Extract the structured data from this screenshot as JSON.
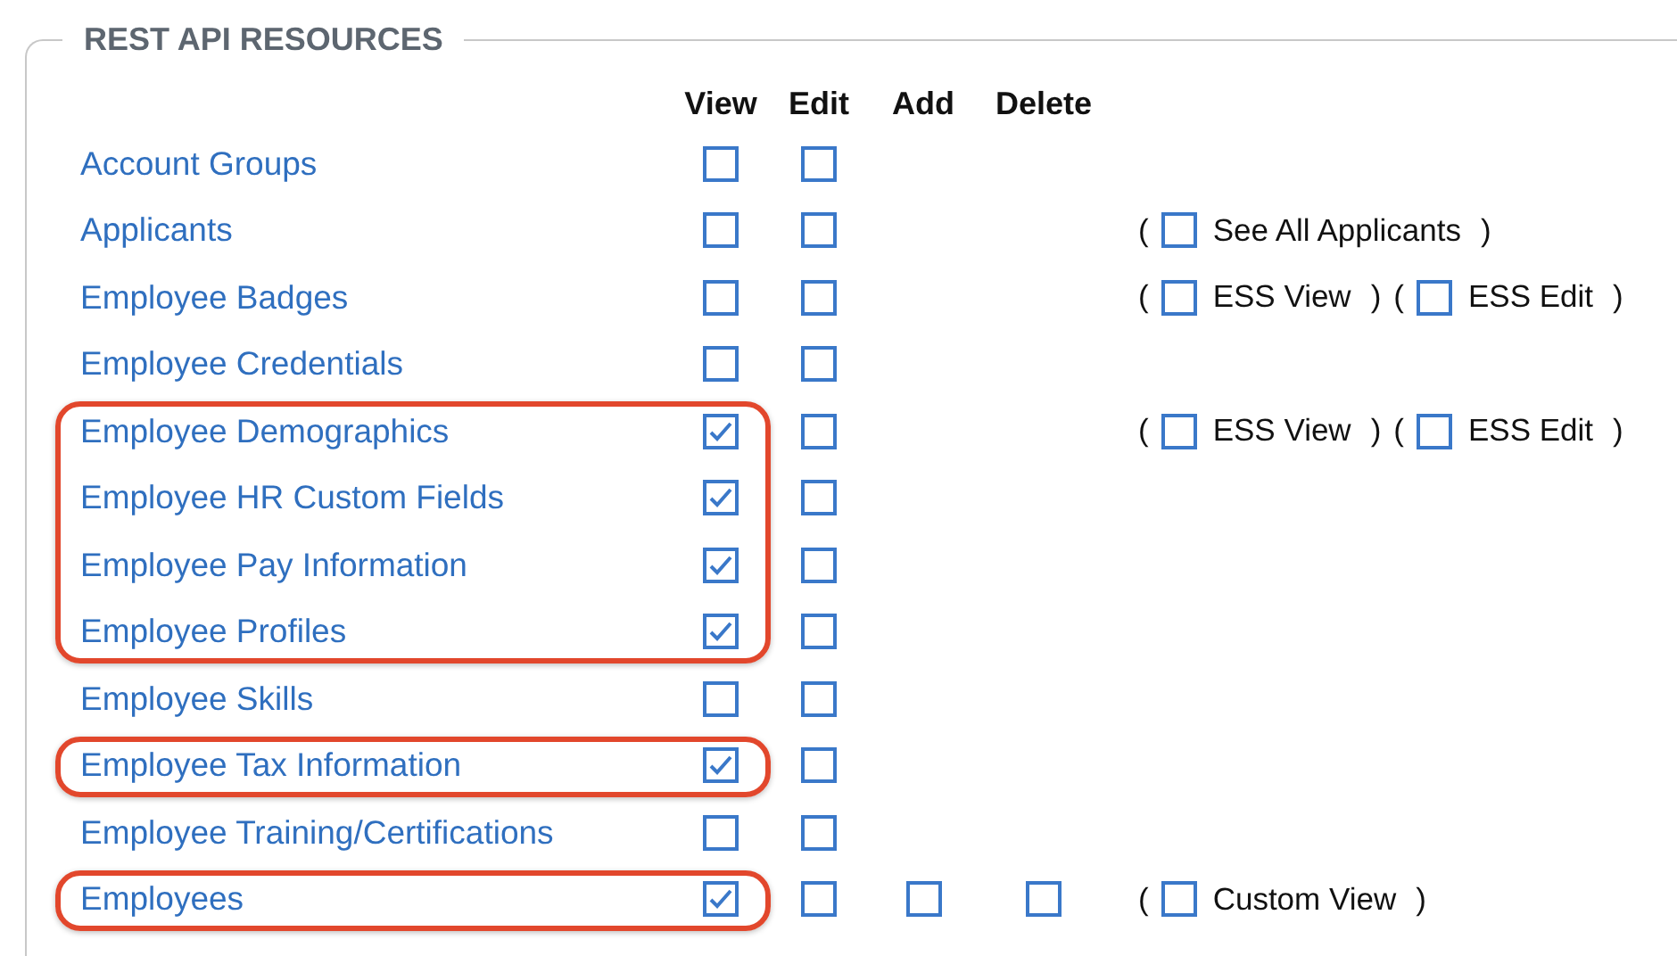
{
  "section": {
    "title": "REST API RESOURCES"
  },
  "columns": [
    "View",
    "Edit",
    "Add",
    "Delete"
  ],
  "rows": [
    {
      "name": "Account Groups",
      "highlighted": false,
      "permissions": [
        {
          "checked": false
        },
        {
          "checked": false
        }
      ]
    },
    {
      "name": "Applicants",
      "highlighted": false,
      "permissions": [
        {
          "checked": false
        },
        {
          "checked": false
        }
      ],
      "extras": [
        {
          "open": "(",
          "label": "See All Applicants",
          "close": ")",
          "checked": false
        }
      ]
    },
    {
      "name": "Employee Badges",
      "highlighted": false,
      "permissions": [
        {
          "checked": false
        },
        {
          "checked": false
        }
      ],
      "extras": [
        {
          "open": "(",
          "label": "ESS View",
          "close": ")",
          "checked": false
        },
        {
          "open": "(",
          "label": "ESS Edit",
          "close": ")",
          "checked": false
        }
      ]
    },
    {
      "name": "Employee Credentials",
      "highlighted": false,
      "permissions": [
        {
          "checked": false
        },
        {
          "checked": false
        }
      ]
    },
    {
      "name": "Employee Demographics",
      "highlighted": true,
      "permissions": [
        {
          "checked": true
        },
        {
          "checked": false
        }
      ],
      "extras": [
        {
          "open": "(",
          "label": "ESS View",
          "close": ")",
          "checked": false
        },
        {
          "open": "(",
          "label": "ESS Edit",
          "close": ")",
          "checked": false
        }
      ]
    },
    {
      "name": "Employee HR Custom Fields",
      "highlighted": true,
      "permissions": [
        {
          "checked": true
        },
        {
          "checked": false
        }
      ]
    },
    {
      "name": "Employee Pay Information",
      "highlighted": true,
      "permissions": [
        {
          "checked": true
        },
        {
          "checked": false
        }
      ]
    },
    {
      "name": "Employee Profiles",
      "highlighted": true,
      "permissions": [
        {
          "checked": true
        },
        {
          "checked": false
        }
      ]
    },
    {
      "name": "Employee Skills",
      "highlighted": false,
      "permissions": [
        {
          "checked": false
        },
        {
          "checked": false
        }
      ]
    },
    {
      "name": "Employee Tax Information",
      "highlighted": true,
      "permissions": [
        {
          "checked": true
        },
        {
          "checked": false
        }
      ]
    },
    {
      "name": "Employee Training/Certifications",
      "highlighted": false,
      "permissions": [
        {
          "checked": false
        },
        {
          "checked": false
        }
      ]
    },
    {
      "name": "Employees",
      "highlighted": true,
      "permissions": [
        {
          "checked": true
        },
        {
          "checked": false
        },
        {
          "checked": false
        },
        {
          "checked": false
        }
      ],
      "extras": [
        {
          "open": "(",
          "label": "Custom View",
          "close": ")",
          "checked": false
        }
      ]
    }
  ]
}
